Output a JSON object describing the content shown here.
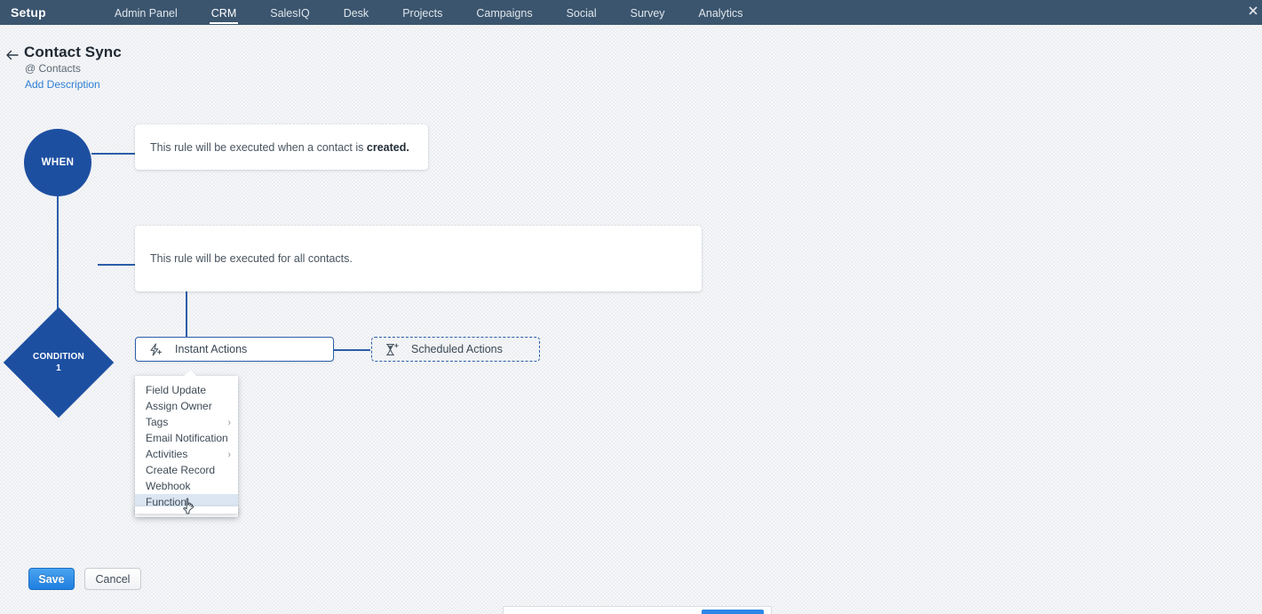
{
  "topnav": {
    "brand": "Setup",
    "items": [
      {
        "label": "Admin Panel",
        "active": false
      },
      {
        "label": "CRM",
        "active": true
      },
      {
        "label": "SalesIQ",
        "active": false
      },
      {
        "label": "Desk",
        "active": false
      },
      {
        "label": "Projects",
        "active": false
      },
      {
        "label": "Campaigns",
        "active": false
      },
      {
        "label": "Social",
        "active": false
      },
      {
        "label": "Survey",
        "active": false
      },
      {
        "label": "Analytics",
        "active": false
      }
    ]
  },
  "header": {
    "back_icon": "back-arrow-icon",
    "title": "Contact Sync",
    "module": "@ Contacts",
    "add_description": "Add Description"
  },
  "flow": {
    "when": {
      "node_label": "WHEN",
      "card_text_prefix": "This rule will be executed when a contact is ",
      "card_text_bold": "created."
    },
    "condition": {
      "node_label_line1": "CONDITION",
      "node_label_line2": "1",
      "card_text": "This rule will be executed for all contacts."
    },
    "actions": {
      "instant": {
        "label": "Instant Actions",
        "icon": "lightning-plus-icon"
      },
      "scheduled": {
        "label": "Scheduled Actions",
        "icon": "hourglass-plus-icon"
      }
    }
  },
  "menu": {
    "items": [
      {
        "label": "Field Update",
        "has_submenu": false,
        "selected": false
      },
      {
        "label": "Assign Owner",
        "has_submenu": false,
        "selected": false
      },
      {
        "label": "Tags",
        "has_submenu": true,
        "selected": false
      },
      {
        "label": "Email Notification",
        "has_submenu": false,
        "selected": false
      },
      {
        "label": "Activities",
        "has_submenu": true,
        "selected": false
      },
      {
        "label": "Create Record",
        "has_submenu": false,
        "selected": false
      },
      {
        "label": "Webhook",
        "has_submenu": false,
        "selected": false
      },
      {
        "label": "Function",
        "has_submenu": false,
        "selected": true
      }
    ],
    "submenu_chevron": "›"
  },
  "footer": {
    "save_label": "Save",
    "cancel_label": "Cancel"
  },
  "colors": {
    "topnav_bg": "#3b556e",
    "node_blue": "#1d4fa1",
    "connector_blue": "#2b5ea8",
    "link_blue": "#2d7fd4",
    "save_blue": "#1f7fe0",
    "menu_selected_bg": "#dbe6f2",
    "canvas_bg": "#eceef1"
  }
}
